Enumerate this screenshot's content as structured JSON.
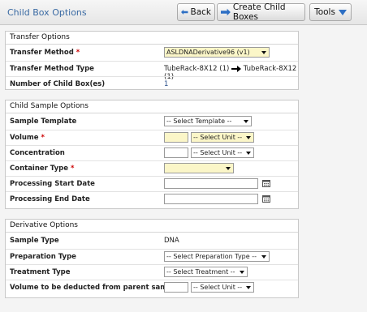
{
  "header": {
    "title": "Child Box Options",
    "back_label": "Back",
    "create_label": "Create Child Boxes",
    "tools_label": "Tools"
  },
  "transfer": {
    "section_title": "Transfer Options",
    "method_label": "Transfer Method",
    "method_value": "ASLDNADerivative96 (v1)",
    "type_label": "Transfer Method Type",
    "type_from": "TubeRack-8X12 (1)",
    "type_to": "TubeRack-8X12 (1)",
    "boxes_label": "Number of Child Box(es)",
    "boxes_value": "1"
  },
  "child": {
    "section_title": "Child Sample Options",
    "template_label": "Sample Template",
    "template_value": "-- Select Template --",
    "volume_label": "Volume",
    "volume_value": "",
    "volume_unit": "-- Select Unit --",
    "conc_label": "Concentration",
    "conc_value": "",
    "conc_unit": "-- Select Unit --",
    "container_label": "Container Type",
    "container_value": "",
    "start_label": "Processing Start Date",
    "start_value": "",
    "end_label": "Processing End Date",
    "end_value": ""
  },
  "derivative": {
    "section_title": "Derivative Options",
    "sample_type_label": "Sample Type",
    "sample_type_value": "DNA",
    "prep_label": "Preparation Type",
    "prep_value": "-- Select Preparation Type --",
    "treatment_label": "Treatment Type",
    "treatment_value": "-- Select Treatment --",
    "deduct_label": "Volume to be deducted from parent sample",
    "deduct_value": "",
    "deduct_unit": "-- Select Unit --"
  },
  "required_mark": "*",
  "colors": {
    "title": "#3a6aa3",
    "required": "#cc0000",
    "required_field_bg": "#fbf6c8"
  }
}
